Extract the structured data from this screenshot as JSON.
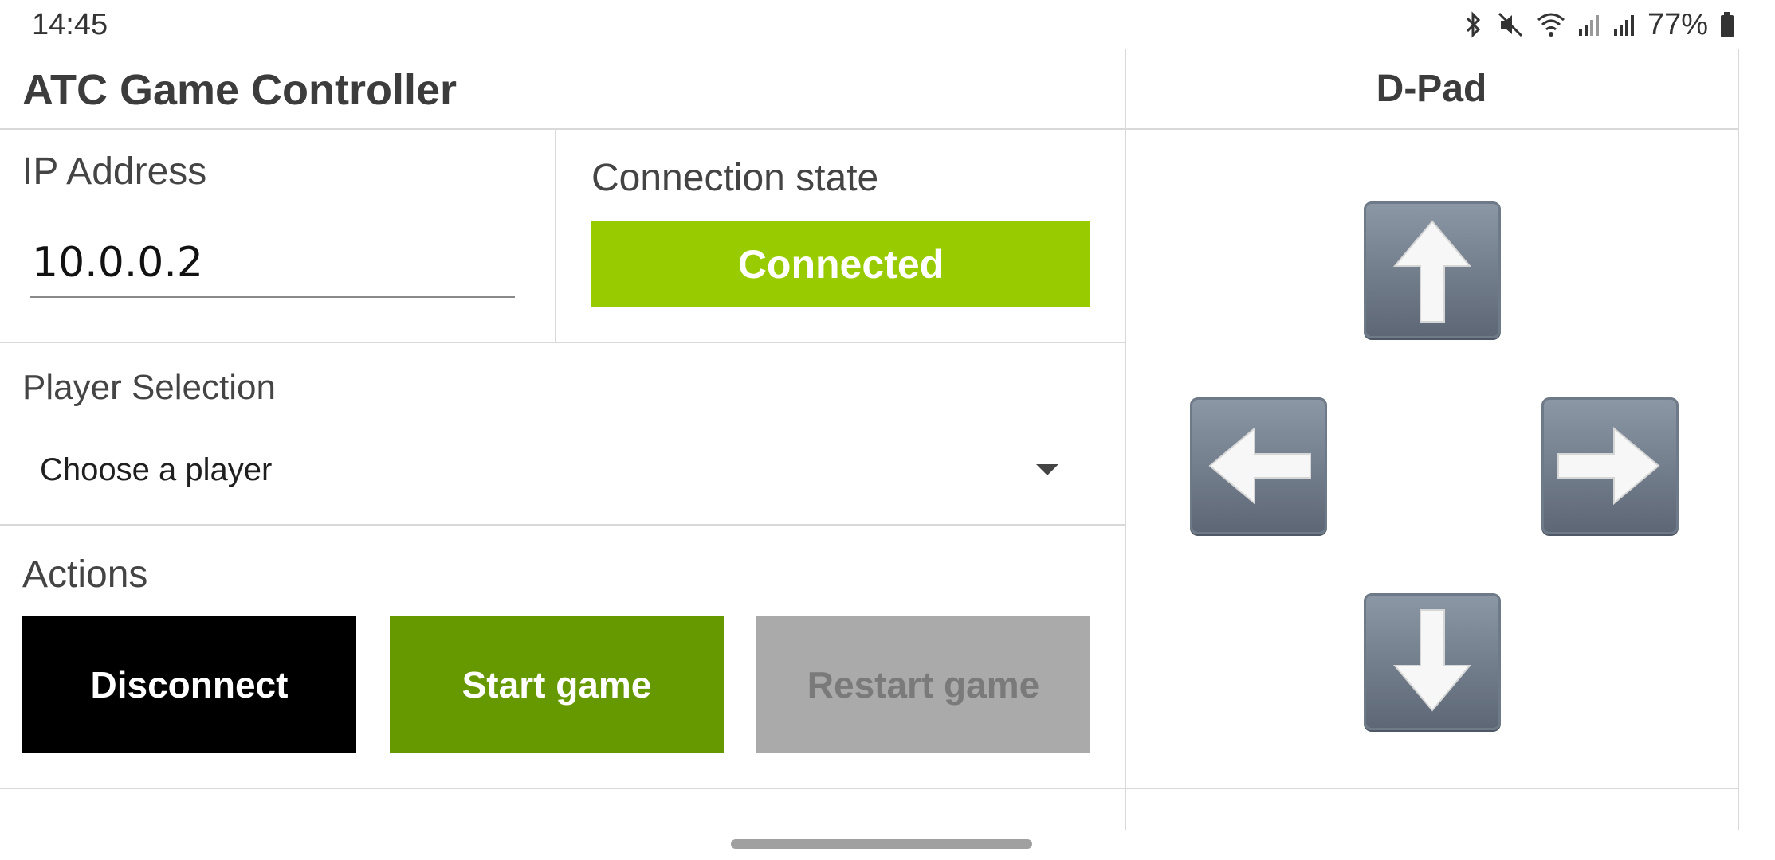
{
  "status_bar": {
    "time": "14:45",
    "battery": "77%",
    "icons": [
      "bluetooth-icon",
      "mute-icon",
      "wifi-icon",
      "signal-icon",
      "signal-icon",
      "battery-icon"
    ]
  },
  "header": {
    "title": "ATC Game Controller",
    "dpad_title": "D-Pad"
  },
  "ip": {
    "label": "IP Address",
    "value": "10.0.0.2"
  },
  "connection": {
    "label": "Connection state",
    "status": "Connected",
    "status_color": "#99cc00"
  },
  "player": {
    "label": "Player Selection",
    "selected": "Choose a player"
  },
  "actions": {
    "label": "Actions",
    "buttons": [
      {
        "label": "Disconnect",
        "color": "#000000"
      },
      {
        "label": "Start game",
        "color": "#669900"
      },
      {
        "label": "Restart game",
        "color": "#aaaaaa"
      }
    ]
  },
  "dpad": {
    "keys": [
      "arrow-up-icon",
      "arrow-left-icon",
      "arrow-right-icon",
      "arrow-down-icon"
    ]
  }
}
